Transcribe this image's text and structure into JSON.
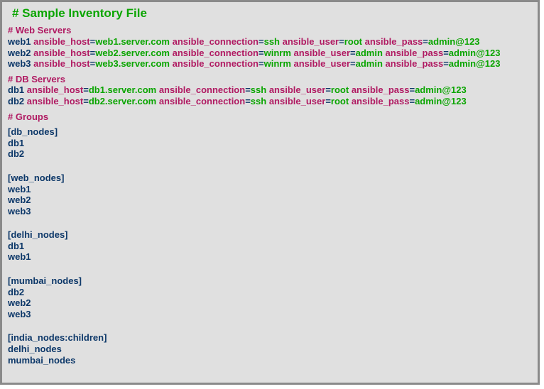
{
  "title": "# Sample Inventory File",
  "sections": {
    "web_comment": "# Web Servers",
    "db_comment": "# DB Servers",
    "groups_comment": "# Groups"
  },
  "hosts": {
    "web": [
      {
        "name": "web1",
        "host": "web1.server.com",
        "conn": "ssh",
        "user": "root",
        "pass": "admin@123"
      },
      {
        "name": "web2",
        "host": "web2.server.com",
        "conn": "winrm",
        "user": "admin",
        "pass": "admin@123"
      },
      {
        "name": "web3",
        "host": "web3.server.com",
        "conn": "winrm",
        "user": "admin",
        "pass": "admin@123"
      }
    ],
    "db": [
      {
        "name": "db1",
        "host": "db1.server.com",
        "conn": "ssh",
        "user": "root",
        "pass": "admin@123"
      },
      {
        "name": "db2",
        "host": "db2.server.com",
        "conn": "ssh",
        "user": "root",
        "pass": "admin@123"
      }
    ]
  },
  "keys": {
    "host": "ansible_host",
    "conn": "ansible_connection",
    "user": "ansible_user",
    "pass": "ansible_pass"
  },
  "groups": [
    {
      "header": "[db_nodes]",
      "members": [
        "db1",
        "db2"
      ]
    },
    {
      "header": "[web_nodes]",
      "members": [
        "web1",
        "web2",
        "web3"
      ]
    },
    {
      "header": "[delhi_nodes]",
      "members": [
        "db1",
        "web1"
      ]
    },
    {
      "header": "[mumbai_nodes]",
      "members": [
        "db2",
        "web2",
        "web3"
      ]
    },
    {
      "header": "[india_nodes:children]",
      "members": [
        "delhi_nodes",
        "mumbai_nodes"
      ]
    }
  ]
}
